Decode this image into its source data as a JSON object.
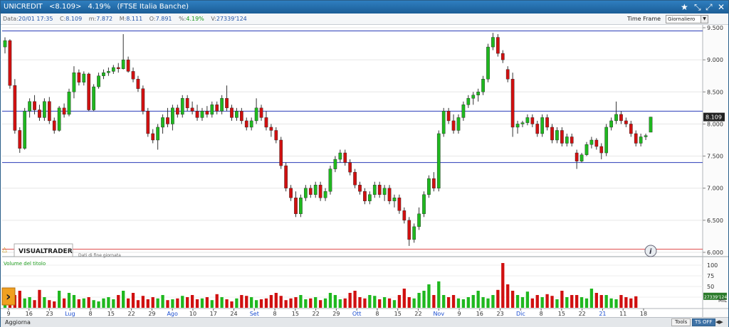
{
  "title": {
    "name": "UNICREDIT",
    "quote": "<8.109>",
    "change": "4.19%",
    "index": "(FTSE Italia Banche)"
  },
  "infobar": {
    "date_key": "Data:",
    "date_val": "20/01 17:35",
    "close_key": "C:",
    "close_val": "8.109",
    "min_key": "m:",
    "min_val": "7.872",
    "max_key": "M:",
    "max_val": "8.111",
    "open_key": "O:",
    "open_val": "7.891",
    "pct_key": "%:",
    "pct_val": "4.19%",
    "vol_key": "V:",
    "vol_val": "27339'124"
  },
  "timeframe": {
    "label": "Time Frame",
    "selected": "Giornaliero"
  },
  "price_axis": {
    "ticks": [
      "9.500",
      "9.000",
      "8.500",
      "8.000",
      "7.500",
      "7.000",
      "6.500",
      "6.000"
    ],
    "current": "8.109"
  },
  "volume_axis": {
    "ticks": [
      "100",
      "75",
      "50",
      "25"
    ],
    "current": "27339'124",
    "unit": "MIL"
  },
  "panel": {
    "logo": "VISUALTRADER",
    "subtitle": "Dati di fine giornata",
    "volume_label": "Volume del titolo"
  },
  "x_axis": {
    "labels": [
      {
        "t": "9",
        "m": false
      },
      {
        "t": "16",
        "m": false
      },
      {
        "t": "23",
        "m": false
      },
      {
        "t": "Lug",
        "m": true
      },
      {
        "t": "8",
        "m": false
      },
      {
        "t": "15",
        "m": false
      },
      {
        "t": "22",
        "m": false
      },
      {
        "t": "29",
        "m": false
      },
      {
        "t": "Ago",
        "m": true
      },
      {
        "t": "10",
        "m": false
      },
      {
        "t": "17",
        "m": false
      },
      {
        "t": "24",
        "m": false
      },
      {
        "t": "Set",
        "m": true
      },
      {
        "t": "8",
        "m": false
      },
      {
        "t": "15",
        "m": false
      },
      {
        "t": "22",
        "m": false
      },
      {
        "t": "29",
        "m": false
      },
      {
        "t": "Ott",
        "m": true
      },
      {
        "t": "8",
        "m": false
      },
      {
        "t": "15",
        "m": false
      },
      {
        "t": "22",
        "m": false
      },
      {
        "t": "Nov",
        "m": true
      },
      {
        "t": "9",
        "m": false
      },
      {
        "t": "16",
        "m": false
      },
      {
        "t": "23",
        "m": false
      },
      {
        "t": "Dic",
        "m": true
      },
      {
        "t": "8",
        "m": false
      },
      {
        "t": "15",
        "m": false
      },
      {
        "t": "22",
        "m": false
      },
      {
        "t": "21",
        "m": true
      },
      {
        "t": "11",
        "m": false
      },
      {
        "t": "18",
        "m": false
      }
    ]
  },
  "statusbar": {
    "refresh": "Aggiorna",
    "tools": "Tools",
    "tsoff": "TS OFF"
  },
  "colors": {
    "up": "#1fb81f",
    "down": "#d01010",
    "hline": "#2a3cb8",
    "support": "#e05050",
    "titlebar": "#1b5d96"
  },
  "chart_data": {
    "type": "candlestick",
    "price_range": [
      6.0,
      9.5
    ],
    "horizontal_lines": [
      9.45,
      8.2,
      7.4,
      6.05
    ],
    "candles": [
      [
        9.2,
        9.35,
        9.1,
        9.3
      ],
      [
        9.3,
        9.32,
        8.55,
        8.6
      ],
      [
        8.6,
        8.7,
        7.85,
        7.9
      ],
      [
        7.9,
        7.95,
        7.55,
        7.62
      ],
      [
        7.62,
        8.25,
        7.6,
        8.2
      ],
      [
        8.2,
        8.4,
        8.1,
        8.35
      ],
      [
        8.35,
        8.45,
        8.15,
        8.22
      ],
      [
        8.22,
        8.3,
        8.05,
        8.1
      ],
      [
        8.1,
        8.4,
        8.05,
        8.35
      ],
      [
        8.35,
        8.42,
        8.0,
        8.05
      ],
      [
        8.05,
        8.1,
        7.85,
        7.9
      ],
      [
        7.9,
        8.28,
        7.88,
        8.25
      ],
      [
        8.25,
        8.32,
        8.1,
        8.15
      ],
      [
        8.15,
        8.55,
        8.12,
        8.5
      ],
      [
        8.5,
        8.9,
        8.4,
        8.8
      ],
      [
        8.8,
        8.85,
        8.6,
        8.65
      ],
      [
        8.65,
        8.82,
        8.6,
        8.78
      ],
      [
        8.78,
        8.8,
        8.2,
        8.22
      ],
      [
        8.22,
        8.62,
        8.2,
        8.58
      ],
      [
        8.58,
        8.8,
        8.55,
        8.75
      ],
      [
        8.75,
        8.85,
        8.7,
        8.8
      ],
      [
        8.8,
        8.88,
        8.75,
        8.82
      ],
      [
        8.82,
        8.92,
        8.78,
        8.88
      ],
      [
        8.88,
        8.95,
        8.8,
        8.86
      ],
      [
        8.86,
        9.4,
        8.85,
        9.0
      ],
      [
        9.0,
        9.05,
        8.8,
        8.82
      ],
      [
        8.82,
        8.88,
        8.65,
        8.7
      ],
      [
        8.7,
        8.75,
        8.5,
        8.55
      ],
      [
        8.55,
        8.6,
        8.15,
        8.2
      ],
      [
        8.2,
        8.25,
        7.8,
        7.85
      ],
      [
        7.85,
        7.92,
        7.7,
        7.75
      ],
      [
        7.75,
        8.0,
        7.6,
        7.95
      ],
      [
        7.95,
        8.15,
        7.85,
        8.1
      ],
      [
        8.1,
        8.25,
        7.95,
        8.0
      ],
      [
        8.0,
        8.3,
        7.9,
        8.25
      ],
      [
        8.25,
        8.3,
        8.1,
        8.15
      ],
      [
        8.15,
        8.45,
        8.1,
        8.4
      ],
      [
        8.4,
        8.45,
        8.2,
        8.25
      ],
      [
        8.25,
        8.35,
        8.15,
        8.2
      ],
      [
        8.2,
        8.3,
        8.05,
        8.1
      ],
      [
        8.1,
        8.25,
        8.05,
        8.2
      ],
      [
        8.2,
        8.28,
        8.1,
        8.15
      ],
      [
        8.15,
        8.35,
        8.1,
        8.3
      ],
      [
        8.3,
        8.35,
        8.15,
        8.2
      ],
      [
        8.2,
        8.45,
        8.15,
        8.4
      ],
      [
        8.4,
        8.6,
        8.2,
        8.25
      ],
      [
        8.25,
        8.3,
        8.05,
        8.1
      ],
      [
        8.1,
        8.25,
        8.05,
        8.2
      ],
      [
        8.2,
        8.25,
        8.0,
        8.05
      ],
      [
        8.05,
        8.1,
        7.9,
        7.95
      ],
      [
        7.95,
        8.1,
        7.9,
        8.05
      ],
      [
        8.05,
        8.4,
        8.0,
        8.25
      ],
      [
        8.25,
        8.3,
        8.05,
        8.1
      ],
      [
        8.1,
        8.2,
        7.9,
        7.95
      ],
      [
        7.95,
        8.0,
        7.8,
        7.9
      ],
      [
        7.9,
        7.95,
        7.7,
        7.75
      ],
      [
        7.75,
        7.8,
        7.3,
        7.35
      ],
      [
        7.35,
        7.4,
        6.95,
        7.0
      ],
      [
        7.0,
        7.05,
        6.8,
        6.85
      ],
      [
        6.85,
        6.95,
        6.55,
        6.6
      ],
      [
        6.6,
        6.9,
        6.55,
        6.85
      ],
      [
        6.85,
        7.05,
        6.8,
        7.0
      ],
      [
        7.0,
        7.05,
        6.85,
        6.9
      ],
      [
        6.9,
        7.1,
        6.85,
        7.05
      ],
      [
        7.05,
        7.1,
        6.8,
        6.85
      ],
      [
        6.85,
        7.0,
        6.8,
        6.95
      ],
      [
        6.95,
        7.35,
        6.9,
        7.3
      ],
      [
        7.3,
        7.5,
        7.25,
        7.45
      ],
      [
        7.45,
        7.6,
        7.4,
        7.55
      ],
      [
        7.55,
        7.6,
        7.35,
        7.4
      ],
      [
        7.4,
        7.45,
        7.2,
        7.25
      ],
      [
        7.25,
        7.3,
        7.0,
        7.05
      ],
      [
        7.05,
        7.1,
        6.9,
        6.95
      ],
      [
        6.95,
        7.0,
        6.75,
        6.8
      ],
      [
        6.8,
        6.95,
        6.75,
        6.9
      ],
      [
        6.9,
        7.1,
        6.85,
        7.05
      ],
      [
        7.05,
        7.1,
        6.85,
        6.9
      ],
      [
        6.9,
        7.05,
        6.8,
        7.0
      ],
      [
        7.0,
        7.05,
        6.75,
        6.8
      ],
      [
        6.8,
        6.9,
        6.7,
        6.85
      ],
      [
        6.85,
        6.9,
        6.6,
        6.65
      ],
      [
        6.65,
        6.7,
        6.45,
        6.5
      ],
      [
        6.5,
        6.55,
        6.1,
        6.2
      ],
      [
        6.2,
        6.45,
        6.15,
        6.4
      ],
      [
        6.4,
        6.7,
        6.35,
        6.6
      ],
      [
        6.6,
        6.95,
        6.55,
        6.9
      ],
      [
        6.9,
        7.2,
        6.85,
        7.15
      ],
      [
        7.15,
        7.25,
        6.95,
        7.0
      ],
      [
        7.0,
        7.9,
        6.95,
        7.85
      ],
      [
        7.85,
        8.25,
        7.8,
        8.2
      ],
      [
        8.2,
        8.25,
        8.0,
        8.05
      ],
      [
        8.05,
        8.15,
        7.85,
        7.9
      ],
      [
        7.9,
        8.15,
        7.85,
        8.1
      ],
      [
        8.1,
        8.35,
        8.05,
        8.3
      ],
      [
        8.3,
        8.45,
        8.25,
        8.4
      ],
      [
        8.4,
        8.5,
        8.3,
        8.45
      ],
      [
        8.45,
        8.55,
        8.35,
        8.5
      ],
      [
        8.5,
        8.75,
        8.45,
        8.7
      ],
      [
        8.7,
        9.25,
        8.65,
        9.2
      ],
      [
        9.2,
        9.42,
        9.15,
        9.35
      ],
      [
        9.35,
        9.4,
        9.05,
        9.1
      ],
      [
        9.1,
        9.15,
        8.95,
        9.0
      ],
      [
        8.85,
        8.9,
        8.65,
        8.7
      ],
      [
        8.7,
        8.8,
        7.8,
        7.95
      ],
      [
        7.95,
        8.05,
        7.85,
        8.0
      ],
      [
        8.0,
        8.05,
        7.95,
        8.02
      ],
      [
        8.02,
        8.15,
        7.98,
        8.1
      ],
      [
        8.1,
        8.15,
        7.95,
        8.0
      ],
      [
        8.0,
        8.05,
        7.8,
        7.85
      ],
      [
        7.85,
        8.15,
        7.8,
        8.1
      ],
      [
        8.1,
        8.15,
        7.9,
        7.95
      ],
      [
        7.95,
        8.0,
        7.7,
        7.75
      ],
      [
        7.75,
        7.95,
        7.7,
        7.9
      ],
      [
        7.9,
        7.95,
        7.65,
        7.7
      ],
      [
        7.7,
        7.85,
        7.65,
        7.8
      ],
      [
        7.8,
        7.85,
        7.65,
        7.7
      ],
      [
        7.55,
        7.6,
        7.3,
        7.42
      ],
      [
        7.42,
        7.55,
        7.4,
        7.52
      ],
      [
        7.52,
        7.72,
        7.5,
        7.68
      ],
      [
        7.68,
        7.8,
        7.62,
        7.75
      ],
      [
        7.75,
        7.78,
        7.6,
        7.65
      ],
      [
        7.65,
        7.7,
        7.45,
        7.55
      ],
      [
        7.55,
        8.0,
        7.5,
        7.95
      ],
      [
        7.95,
        8.1,
        7.9,
        8.05
      ],
      [
        8.05,
        8.35,
        8.0,
        8.15
      ],
      [
        8.15,
        8.2,
        8.0,
        8.05
      ],
      [
        8.05,
        8.1,
        7.95,
        8.0
      ],
      [
        8.0,
        8.05,
        7.8,
        7.85
      ],
      [
        7.85,
        7.9,
        7.65,
        7.7
      ],
      [
        7.7,
        7.85,
        7.65,
        7.8
      ],
      [
        7.8,
        7.85,
        7.75,
        7.82
      ],
      [
        7.872,
        8.111,
        7.872,
        8.109
      ]
    ],
    "volumes": [
      20,
      38,
      30,
      40,
      22,
      25,
      18,
      42,
      25,
      18,
      15,
      40,
      22,
      35,
      30,
      20,
      22,
      25,
      18,
      15,
      22,
      25,
      20,
      30,
      40,
      22,
      35,
      18,
      28,
      20,
      25,
      22,
      30,
      18,
      20,
      22,
      28,
      25,
      30,
      20,
      22,
      25,
      18,
      32,
      25,
      20,
      15,
      22,
      30,
      28,
      25,
      18,
      20,
      22,
      30,
      35,
      28,
      18,
      22,
      25,
      30,
      20,
      22,
      25,
      18,
      22,
      35,
      30,
      20,
      22,
      35,
      40,
      25,
      22,
      30,
      28,
      20,
      25,
      22,
      18,
      30,
      45,
      25,
      22,
      35,
      40,
      55,
      30,
      62,
      30,
      25,
      30,
      22,
      20,
      25,
      30,
      40,
      25,
      22,
      30,
      42,
      105,
      55,
      40,
      30,
      25,
      38,
      22,
      30,
      25,
      32,
      28,
      20,
      40,
      25,
      30,
      30,
      25,
      22,
      45,
      35,
      30,
      30,
      22,
      20,
      30,
      25,
      22,
      27
    ]
  }
}
